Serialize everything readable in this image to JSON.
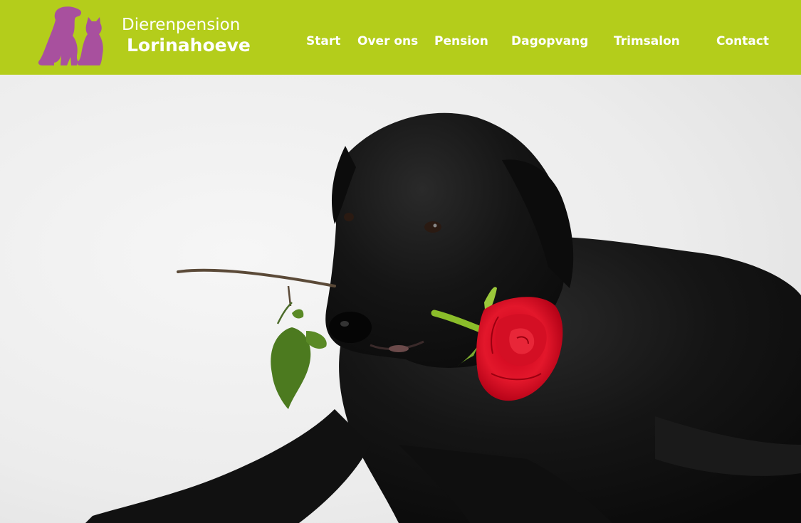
{
  "brand": {
    "line1": "Dierenpension",
    "line2": "Lorinahoeve",
    "logo_icon": "dog-and-cat-silhouette-icon",
    "logo_color": "#a8509e"
  },
  "header": {
    "background_color": "#b4cd1b"
  },
  "nav": {
    "items": [
      {
        "label": "Start"
      },
      {
        "label": "Over ons"
      },
      {
        "label": "Pension"
      },
      {
        "label": "Dagopvang"
      },
      {
        "label": "Trimsalon"
      },
      {
        "label": "Contact"
      }
    ]
  },
  "hero": {
    "image": "black-labrador-holding-red-rose-photo"
  }
}
